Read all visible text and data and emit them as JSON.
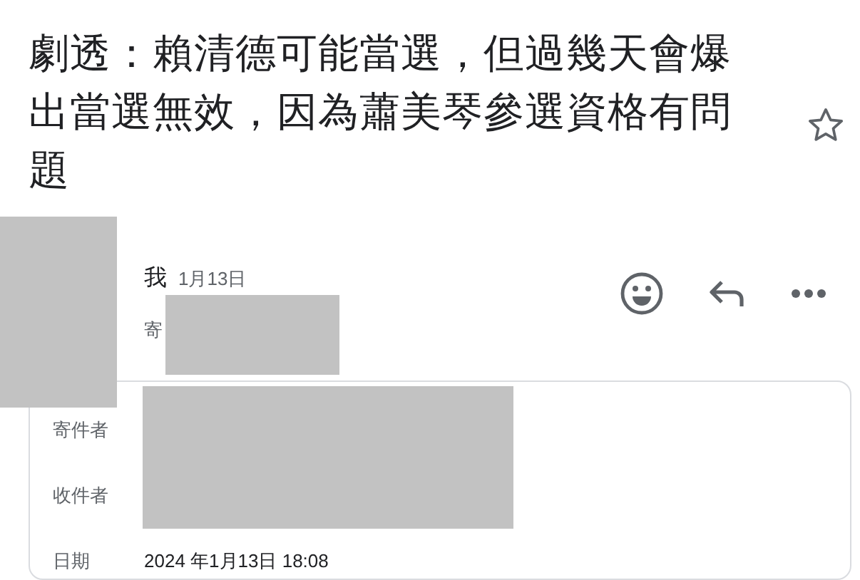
{
  "subject": "劇透：賴清德可能當選，但過幾天會爆出當選無效，因為蕭美琴參選資格有問題",
  "starred": false,
  "sender": {
    "name": "我",
    "date": "1月13日",
    "to_prefix": "寄"
  },
  "details": [
    {
      "label": "寄件者"
    },
    {
      "label": "收件者"
    },
    {
      "label": "日期",
      "value": "2024 年1月13日 18:08"
    }
  ]
}
